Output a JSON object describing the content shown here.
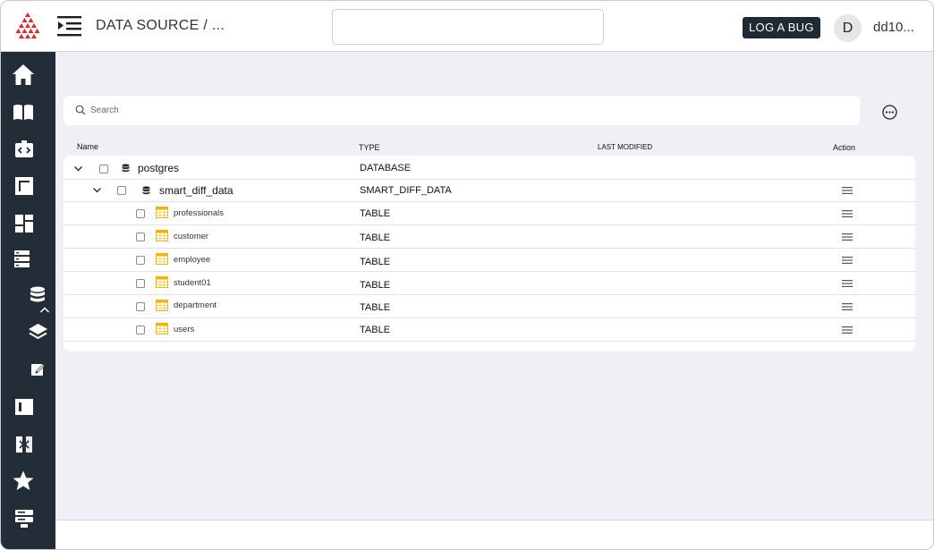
{
  "header": {
    "breadcrumb": "DATA SOURCE / ...",
    "bug_button": "LOG  A BUG",
    "avatar_initial": "D",
    "username": "dd10..."
  },
  "sidebar": {
    "items": [
      {
        "icon": "home-icon"
      },
      {
        "icon": "book-icon"
      },
      {
        "icon": "code-box-icon"
      },
      {
        "icon": "layout-icon"
      },
      {
        "icon": "dashboard-icon"
      },
      {
        "icon": "server-icon"
      },
      {
        "icon": "database-icon"
      },
      {
        "icon": "layers-icon"
      },
      {
        "icon": "edit-note-icon"
      },
      {
        "icon": "panel-icon"
      },
      {
        "icon": "compare-icon"
      },
      {
        "icon": "star-icon"
      },
      {
        "icon": "storage-icon"
      }
    ]
  },
  "search": {
    "placeholder": "Search",
    "value": ""
  },
  "columns": {
    "name": "Name",
    "type": "TYPE",
    "last_modified": "LAST MODIFIED",
    "action": "Action"
  },
  "rows": [
    {
      "name": "postgres",
      "type": "DATABASE",
      "last_modified": "",
      "level": 0
    },
    {
      "name": "smart_diff_data",
      "type": "SMART_DIFF_DATA",
      "last_modified": "",
      "level": 1
    },
    {
      "name": "professionals",
      "type": "TABLE",
      "last_modified": "",
      "level": 2
    },
    {
      "name": "customer",
      "type": "TABLE",
      "last_modified": "",
      "level": 2
    },
    {
      "name": "employee",
      "type": "TABLE",
      "last_modified": "",
      "level": 2
    },
    {
      "name": "student01",
      "type": "TABLE",
      "last_modified": "",
      "level": 2
    },
    {
      "name": "department",
      "type": "TABLE",
      "last_modified": "",
      "level": 2
    },
    {
      "name": "users",
      "type": "TABLE",
      "last_modified": "",
      "level": 2
    }
  ],
  "colors": {
    "sidebar": "#222d38",
    "content_bg": "#eef0f6",
    "bug_button": "#1f2a35",
    "logo_red": "#e0252b",
    "table_icon": "#f2b400"
  }
}
